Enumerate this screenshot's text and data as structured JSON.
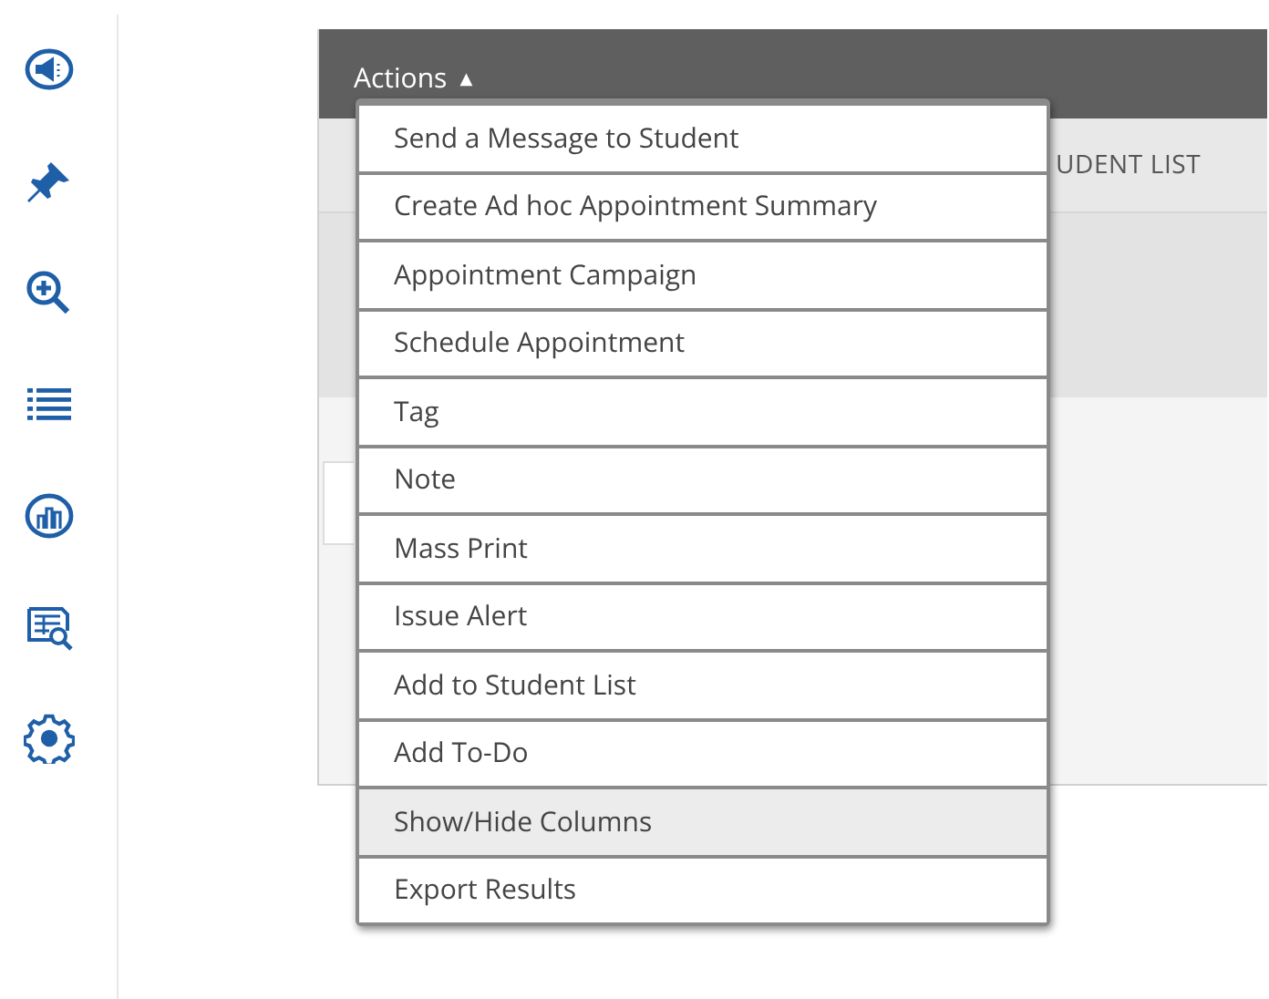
{
  "sidebar": {
    "items": [
      {
        "kind": "megaphone"
      },
      {
        "kind": "pin"
      },
      {
        "kind": "zoom"
      },
      {
        "kind": "list"
      },
      {
        "kind": "chart"
      },
      {
        "kind": "report"
      },
      {
        "kind": "settings"
      }
    ]
  },
  "panel": {
    "actions_label": "Actions",
    "caret": "▲",
    "column_header": "UDENT LIST"
  },
  "menu": {
    "items": [
      {
        "label": "Send a Message to Student",
        "selected": false
      },
      {
        "label": "Create Ad hoc Appointment Summary",
        "selected": false
      },
      {
        "label": "Appointment Campaign",
        "selected": false
      },
      {
        "label": "Schedule Appointment",
        "selected": false
      },
      {
        "label": "Tag",
        "selected": false
      },
      {
        "label": "Note",
        "selected": false
      },
      {
        "label": "Mass Print",
        "selected": false
      },
      {
        "label": "Issue Alert",
        "selected": false
      },
      {
        "label": "Add to Student List",
        "selected": false
      },
      {
        "label": "Add To-Do",
        "selected": false
      },
      {
        "label": "Show/Hide Columns",
        "selected": true
      },
      {
        "label": "Export Results",
        "selected": false
      }
    ]
  }
}
